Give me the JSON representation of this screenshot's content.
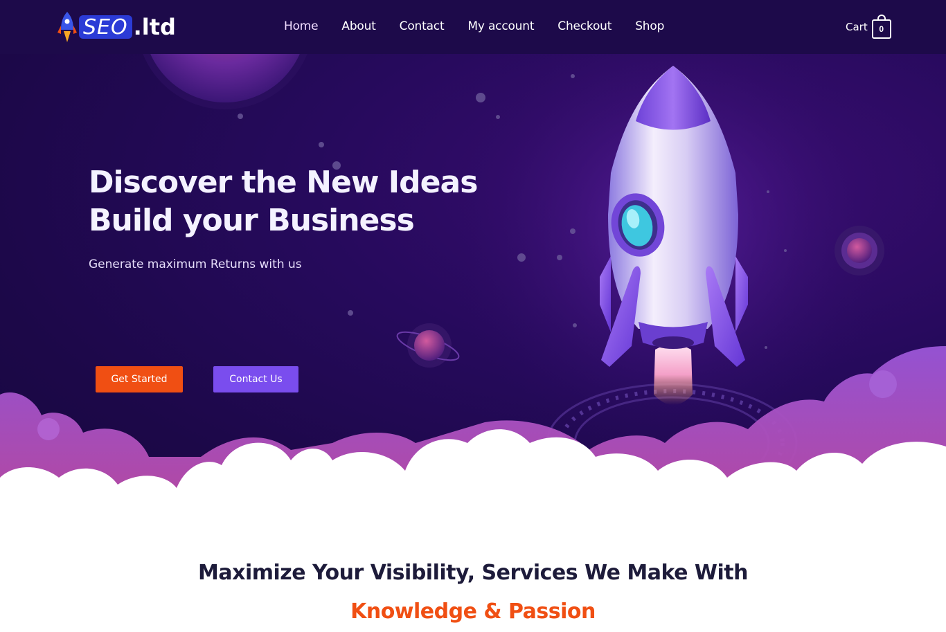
{
  "brand": {
    "logo_main": "SEO",
    "logo_suffix": ".ltd"
  },
  "nav": {
    "items": [
      {
        "label": "Home",
        "active": true
      },
      {
        "label": "About"
      },
      {
        "label": "Contact"
      },
      {
        "label": "My account"
      },
      {
        "label": "Checkout"
      },
      {
        "label": "Shop"
      }
    ]
  },
  "cart": {
    "label": "Cart",
    "count": "0"
  },
  "hero": {
    "title_line1": "Discover the New Ideas",
    "title_line2": "Build your Business",
    "subtitle": "Generate maximum Returns with us",
    "cta_primary": "Get Started",
    "cta_secondary": "Contact Us"
  },
  "services": {
    "heading": "Maximize Your Visibility, Services We Make With",
    "accent": "Knowledge & Passion"
  },
  "colors": {
    "header_bg": "#1d0a4a",
    "hero_bg": "#260a5c",
    "primary_button": "#f04f13",
    "secondary_button": "#7a4dee",
    "accent_text": "#f04f13",
    "rocket_body": "#cbbcf2"
  },
  "icons": {
    "logo": "rocket-icon",
    "cart": "shopping-bag-icon"
  }
}
